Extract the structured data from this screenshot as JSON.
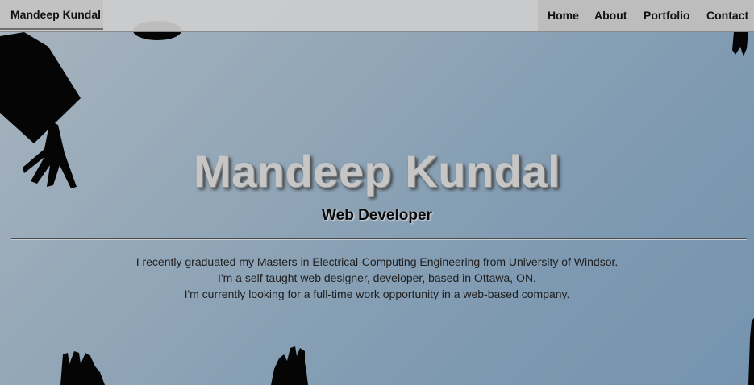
{
  "brand": "Mandeep Kundal",
  "nav": {
    "items": [
      {
        "label": "Home"
      },
      {
        "label": "About"
      },
      {
        "label": "Portfolio"
      },
      {
        "label": "Contact"
      }
    ]
  },
  "hero": {
    "name": "Mandeep Kundal",
    "role": "Web Developer",
    "bio": [
      "I recently graduated my Masters in Electrical-Computing Engineering from University of Windsor.",
      "I'm a self taught web designer, developer, based in Ottawa, ON.",
      "I'm currently looking for a full-time work opportunity in a web-based company."
    ]
  },
  "icons": {
    "graduation_caps": "graduation-cap-silhouette",
    "hands": "raised-hand-silhouette"
  }
}
